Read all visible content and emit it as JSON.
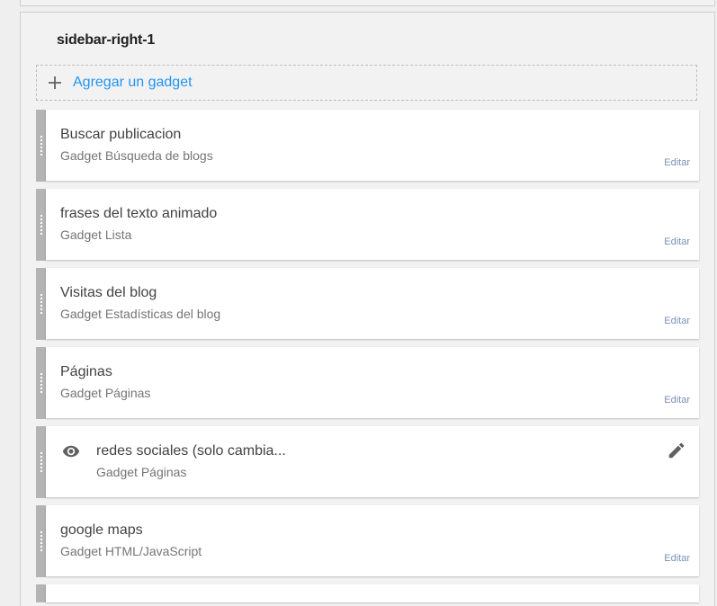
{
  "section": {
    "title": "sidebar-right-1",
    "add_gadget_label": "Agregar un gadget"
  },
  "gadgets": [
    {
      "title": "Buscar publicacion",
      "subtitle": "Gadget Búsqueda de blogs",
      "edit_label": "Editar"
    },
    {
      "title": "frases del texto animado",
      "subtitle": "Gadget Lista",
      "edit_label": "Editar"
    },
    {
      "title": "Visitas del blog",
      "subtitle": "Gadget Estadísticas del blog",
      "edit_label": "Editar"
    },
    {
      "title": "Páginas",
      "subtitle": "Gadget Páginas",
      "edit_label": "Editar"
    },
    {
      "title": "redes sociales (solo cambia...",
      "subtitle": "Gadget Páginas",
      "icons": [
        "eye-icon",
        "pencil-icon"
      ]
    },
    {
      "title": "google maps",
      "subtitle": "Gadget HTML/JavaScript",
      "edit_label": "Editar"
    }
  ],
  "colors": {
    "accent": "#2196f3",
    "edit_link": "#7a91b8",
    "handle": "#b4b4b4",
    "background": "#efefef"
  }
}
